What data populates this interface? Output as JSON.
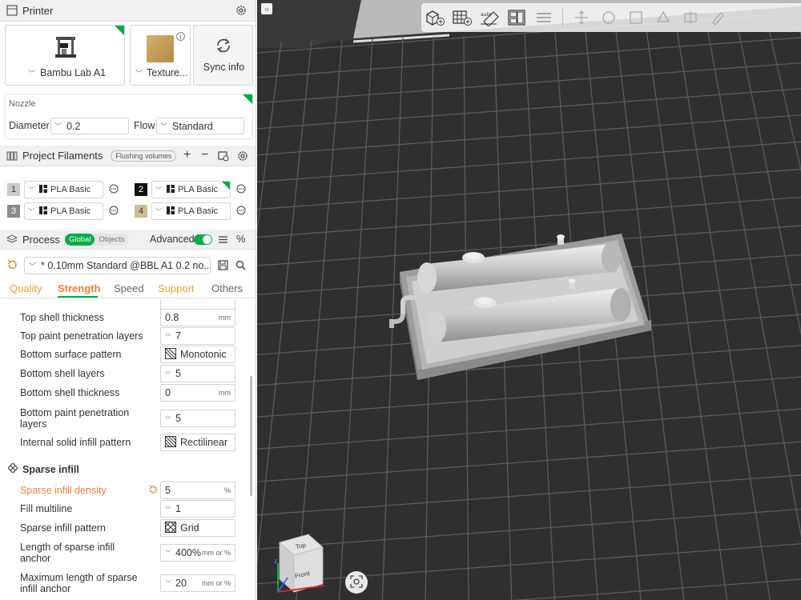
{
  "printer": {
    "section_title": "Printer",
    "printer_name": "Bambu Lab A1",
    "plate_name": "Texture...",
    "sync_label": "Sync info",
    "nozzle_title": "Nozzle",
    "diameter_label": "Diameter",
    "diameter_value": "0.2",
    "flow_label": "Flow",
    "flow_value": "Standard"
  },
  "filaments": {
    "section_title": "Project Filaments",
    "flushing_label": "Flushing volumes",
    "items": [
      {
        "num": "1",
        "name": "PLA Basic",
        "color": "#c9c9c9",
        "numcolor": "#333"
      },
      {
        "num": "2",
        "name": "PLA Basic",
        "color": "#111111",
        "numcolor": "#fff"
      },
      {
        "num": "3",
        "name": "PLA Basic",
        "color": "#8a8a8a",
        "numcolor": "#fff"
      },
      {
        "num": "4",
        "name": "PLA Basic",
        "color": "#cdbf95",
        "numcolor": "#333"
      }
    ]
  },
  "process": {
    "section_title": "Process",
    "global_label": "Global",
    "objects_label": "Objects",
    "advanced_label": "Advanced",
    "preset": "* 0.10mm Standard @BBL A1 0.2 no...",
    "tabs": [
      "Quality",
      "Strength",
      "Speed",
      "Support",
      "Others"
    ],
    "active_tab": "Strength"
  },
  "params": {
    "top_shell_thickness": {
      "label": "Top shell thickness",
      "value": "0.8",
      "unit": "mm"
    },
    "top_paint_layers": {
      "label": "Top paint penetration layers",
      "value": "7"
    },
    "bottom_surface_pattern": {
      "label": "Bottom surface pattern",
      "value": "Monotonic"
    },
    "bottom_shell_layers": {
      "label": "Bottom shell layers",
      "value": "5"
    },
    "bottom_shell_thickness": {
      "label": "Bottom shell thickness",
      "value": "0",
      "unit": "mm"
    },
    "bottom_paint_layers": {
      "label": "Bottom paint penetration layers",
      "value": "5"
    },
    "internal_solid_pattern": {
      "label": "Internal solid infill pattern",
      "value": "Rectilinear"
    },
    "sparse_title": "Sparse infill",
    "sparse_density": {
      "label": "Sparse infill density",
      "value": "5",
      "unit": "%"
    },
    "fill_multiline": {
      "label": "Fill multiline",
      "value": "1"
    },
    "sparse_pattern": {
      "label": "Sparse infill pattern",
      "value": "Grid"
    },
    "anchor_length": {
      "label": "Length of sparse infill anchor",
      "value": "400%",
      "unit": "mm or %"
    },
    "anchor_max": {
      "label": "Maximum length of sparse infill anchor",
      "value": "20",
      "unit": "mm or %"
    }
  },
  "viewport": {
    "cube_top": "Top",
    "cube_front": "Front"
  },
  "colors": {
    "accent": "#00ae42",
    "modified": "#f0803c",
    "viewport_bg": "#2f2f31"
  }
}
